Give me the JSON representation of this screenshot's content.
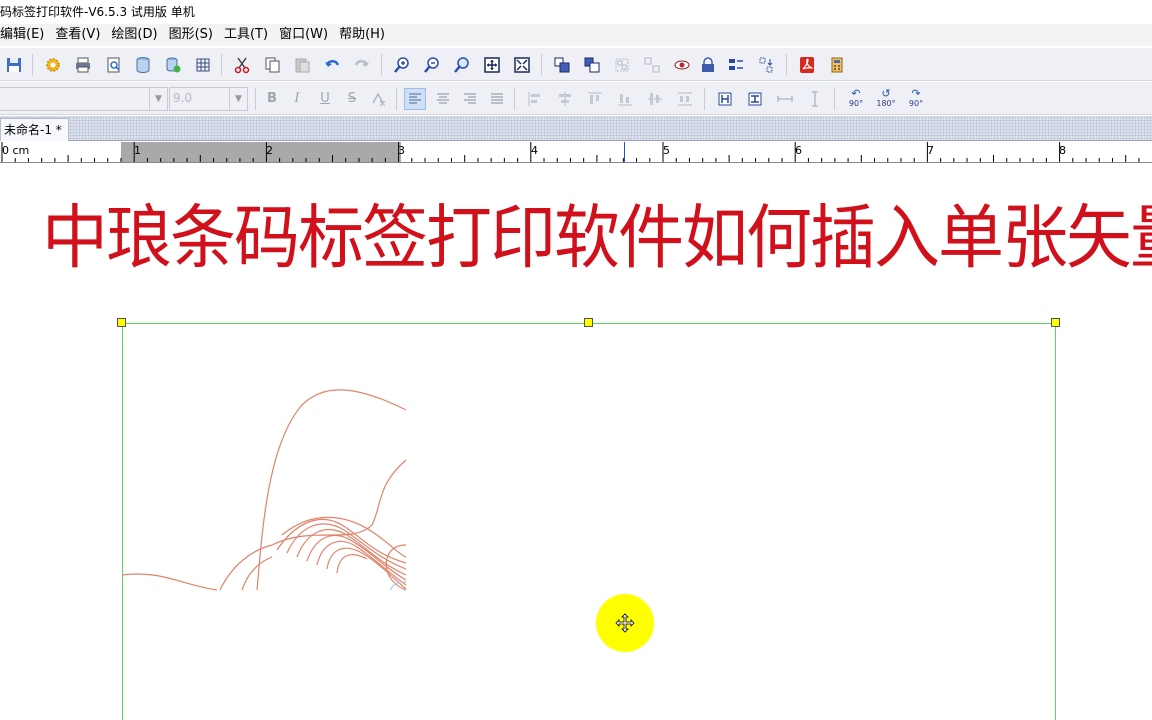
{
  "window": {
    "title": "码标签打印软件-V6.5.3 试用版 单机"
  },
  "menu": {
    "items": [
      {
        "label": "编辑(E)"
      },
      {
        "label": "查看(V)"
      },
      {
        "label": "绘图(D)"
      },
      {
        "label": "图形(S)"
      },
      {
        "label": "工具(T)"
      },
      {
        "label": "窗口(W)"
      },
      {
        "label": "帮助(H)"
      }
    ]
  },
  "toolbar1": {
    "icons": [
      "save-icon",
      "settings-icon",
      "print-icon",
      "print-preview-icon",
      "database-icon",
      "database-connect-icon",
      "grid-icon",
      "cut-icon",
      "copy-icon",
      "paste-icon",
      "undo-icon",
      "redo-icon",
      "zoom-in-icon",
      "zoom-out-icon",
      "zoom-icon",
      "fit-page-icon",
      "fit-all-icon",
      "bring-front-icon",
      "send-back-icon",
      "group-icon",
      "ungroup-icon",
      "preview-eye-icon",
      "lock-icon",
      "align-icon",
      "distribute-icon",
      "pdf-icon",
      "calculator-icon"
    ]
  },
  "toolbar2": {
    "font_name": "",
    "font_size": "9.0",
    "format_buttons": {
      "bold": "B",
      "italic": "I",
      "underline": "U",
      "strike": "S"
    },
    "rotate": {
      "r90": "90°",
      "r180": "180°",
      "r90ccw": "90°"
    }
  },
  "document": {
    "tab_label": "未命名-1 *"
  },
  "ruler": {
    "unit_label": "0 cm",
    "marks": [
      "1",
      "2",
      "3",
      "4",
      "5",
      "6",
      "7",
      "8"
    ]
  },
  "canvas": {
    "headline": "中琅条码标签打印软件如何插入单张矢量图"
  },
  "colors": {
    "headline": "#d0101a",
    "selection": "#5fd35a",
    "handle": "#ffff00",
    "vector_stroke": "#e0836a",
    "cursor_highlight": "#ffff00"
  }
}
